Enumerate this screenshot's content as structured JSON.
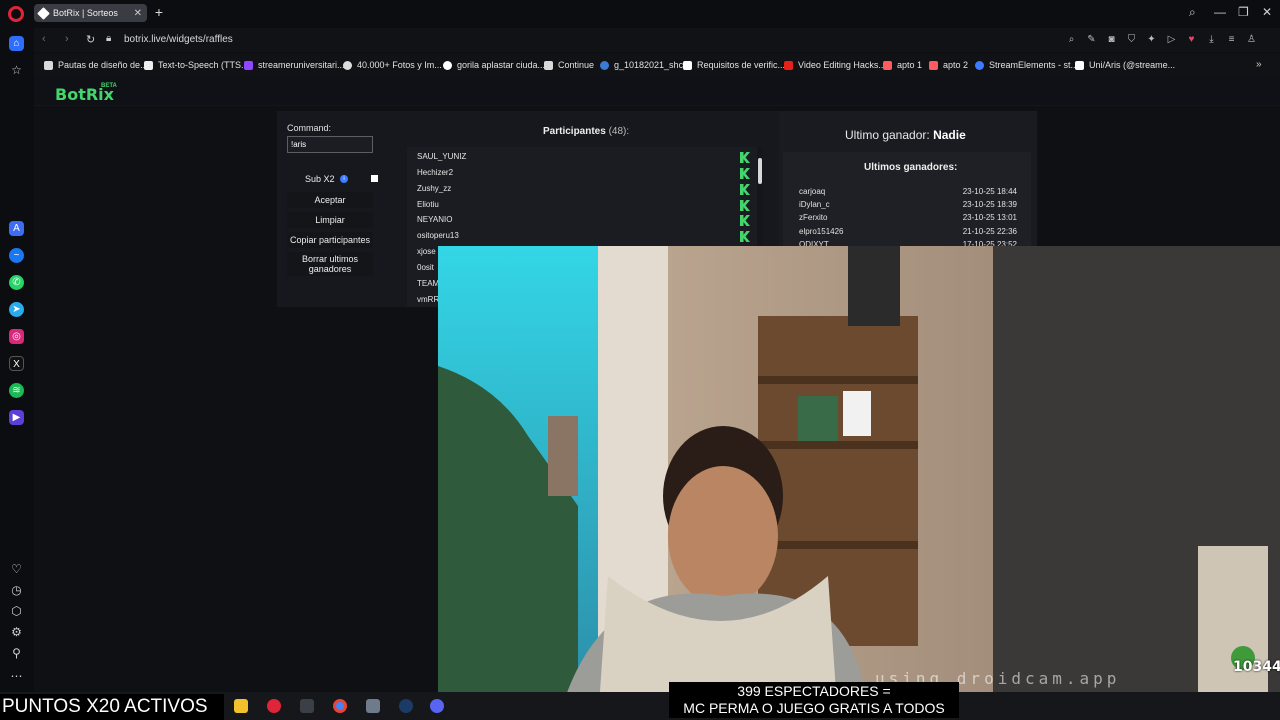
{
  "browser": {
    "tab_title": "BotRix | Sorteos",
    "url": "botrix.live/widgets/raffles",
    "bookmarks": [
      "Pautas de diseño de...",
      "Text-to-Speech (TTS...",
      "streameruniversitari...",
      "40.000+ Fotos y Im...",
      "gorila aplastar ciuda...",
      "Continue",
      "g_10182021_shcc",
      "Requisitos de verific...",
      "Video Editing Hacks...",
      "apto 1",
      "apto 2",
      "StreamElements - st...",
      "Uni/Aris (@streame..."
    ]
  },
  "app": {
    "brand": "BotRix",
    "brand_beta": "BETA"
  },
  "raffle": {
    "command_label": "Command:",
    "command_value": "!aris",
    "sub_x2_label": "Sub X2",
    "accept_label": "Aceptar",
    "clear_label": "Limpiar",
    "copy_label": "Copiar participantes",
    "delete_label": "Borrar ultimos ganadores",
    "participants_title": "Participantes",
    "participants_count": "(48):",
    "participants": [
      "SAUL_YUNIZ",
      "Hechizer2",
      "Zushy_zz",
      "Eliotiu",
      "NEYANIO",
      "ositoperu13",
      "xjose",
      "0osit",
      "TEAM",
      "vmRR"
    ]
  },
  "winners": {
    "last_winner_label": "Ultimo ganador:",
    "last_winner_value": "Nadie",
    "heading": "Ultimos ganadores:",
    "rows": [
      {
        "name": "carjoaq",
        "date": "23-10-25 18:44"
      },
      {
        "name": "iDylan_c",
        "date": "23-10-25 18:39"
      },
      {
        "name": "zFerxito",
        "date": "23-10-25 13:01"
      },
      {
        "name": "elpro151426",
        "date": "21-10-25 22:36"
      },
      {
        "name": "ODIXYT",
        "date": "17-10-25 23:52"
      }
    ]
  },
  "stream": {
    "droidcam_watermark": "using droidcam.app",
    "viewer_count": "10344",
    "banner_line1": "399 ESPECTADORES =",
    "banner_line2": "MC PERMA O JUEGO GRATIS A TODOS",
    "ticker": "PUNTOS X20 ACTIVOS"
  },
  "colors": {
    "kick_green": "#43d66b",
    "opera_red": "#e0243a"
  }
}
